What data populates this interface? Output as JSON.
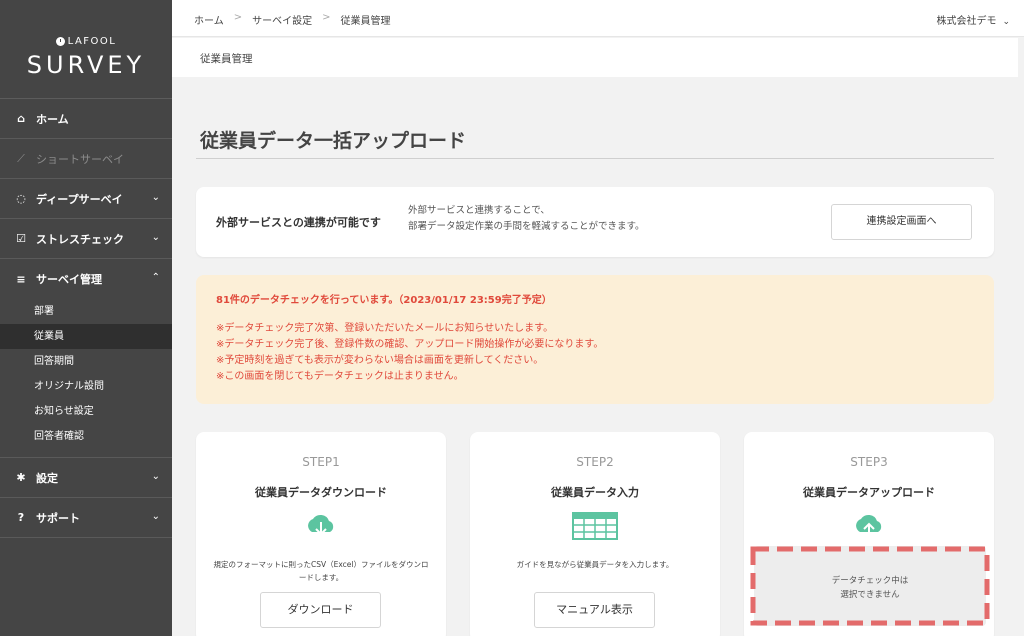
{
  "sidebar": {
    "logo_small": "LAFOOL",
    "logo_big": "SURVEY",
    "items": [
      {
        "label": "ホーム",
        "icon": "home-icon"
      },
      {
        "label": "ショートサーベイ",
        "icon": "chart-line-icon"
      },
      {
        "label": "ディープサーベイ",
        "icon": "circle-arrow-icon"
      },
      {
        "label": "ストレスチェック",
        "icon": "checkbox-icon"
      },
      {
        "label": "サーベイ管理",
        "icon": "sliders-icon"
      },
      {
        "label": "設定",
        "icon": "gear-icon"
      },
      {
        "label": "サポート",
        "icon": "question-icon"
      }
    ],
    "sub_items": [
      "部署",
      "従業員",
      "回答期間",
      "オリジナル設問",
      "お知らせ設定",
      "回答者確認"
    ]
  },
  "topbar": {
    "breadcrumbs": [
      "ホーム",
      "サーベイ設定",
      "従業員管理"
    ],
    "company": "株式会社デモ"
  },
  "subheader": "従業員管理",
  "page_title": "従業員データ一括アップロード",
  "external": {
    "title": "外部サービスとの連携が可能です",
    "desc_line1": "外部サービスと連携することで、",
    "desc_line2": "部署データ設定作業の手間を軽減することができます。",
    "button": "連携設定画面へ"
  },
  "notice": {
    "title": "81件のデータチェックを行っています。（2023/01/17 23:59完了予定）",
    "lines": [
      "※データチェック完了次第、登録いただいたメールにお知らせいたします。",
      "※データチェック完了後、登録件数の確認、アップロード開始操作が必要になります。",
      "※予定時刻を過ぎても表示が変わらない場合は画面を更新してください。",
      "※この画面を閉じてもデータチェックは止まりません。"
    ]
  },
  "steps": [
    {
      "label": "STEP1",
      "name": "従業員データダウンロード",
      "desc": "規定のフォーマットに則ったCSV（Excel）ファイルをダウンロードします。",
      "button": "ダウンロード"
    },
    {
      "label": "STEP2",
      "name": "従業員データ入力",
      "desc": "ガイドを見ながら従業員データを入力します。",
      "button": "マニュアル表示"
    },
    {
      "label": "STEP3",
      "name": "従業員データアップロード",
      "locked_line1": "データチェック中は",
      "locked_line2": "選択できません"
    }
  ],
  "colors": {
    "sidebar_bg": "#454545",
    "accent_green": "#5cc4a0",
    "notice_bg": "#fcefd7",
    "notice_text": "#e0493b",
    "dash_highlight": "#e36b6b"
  }
}
